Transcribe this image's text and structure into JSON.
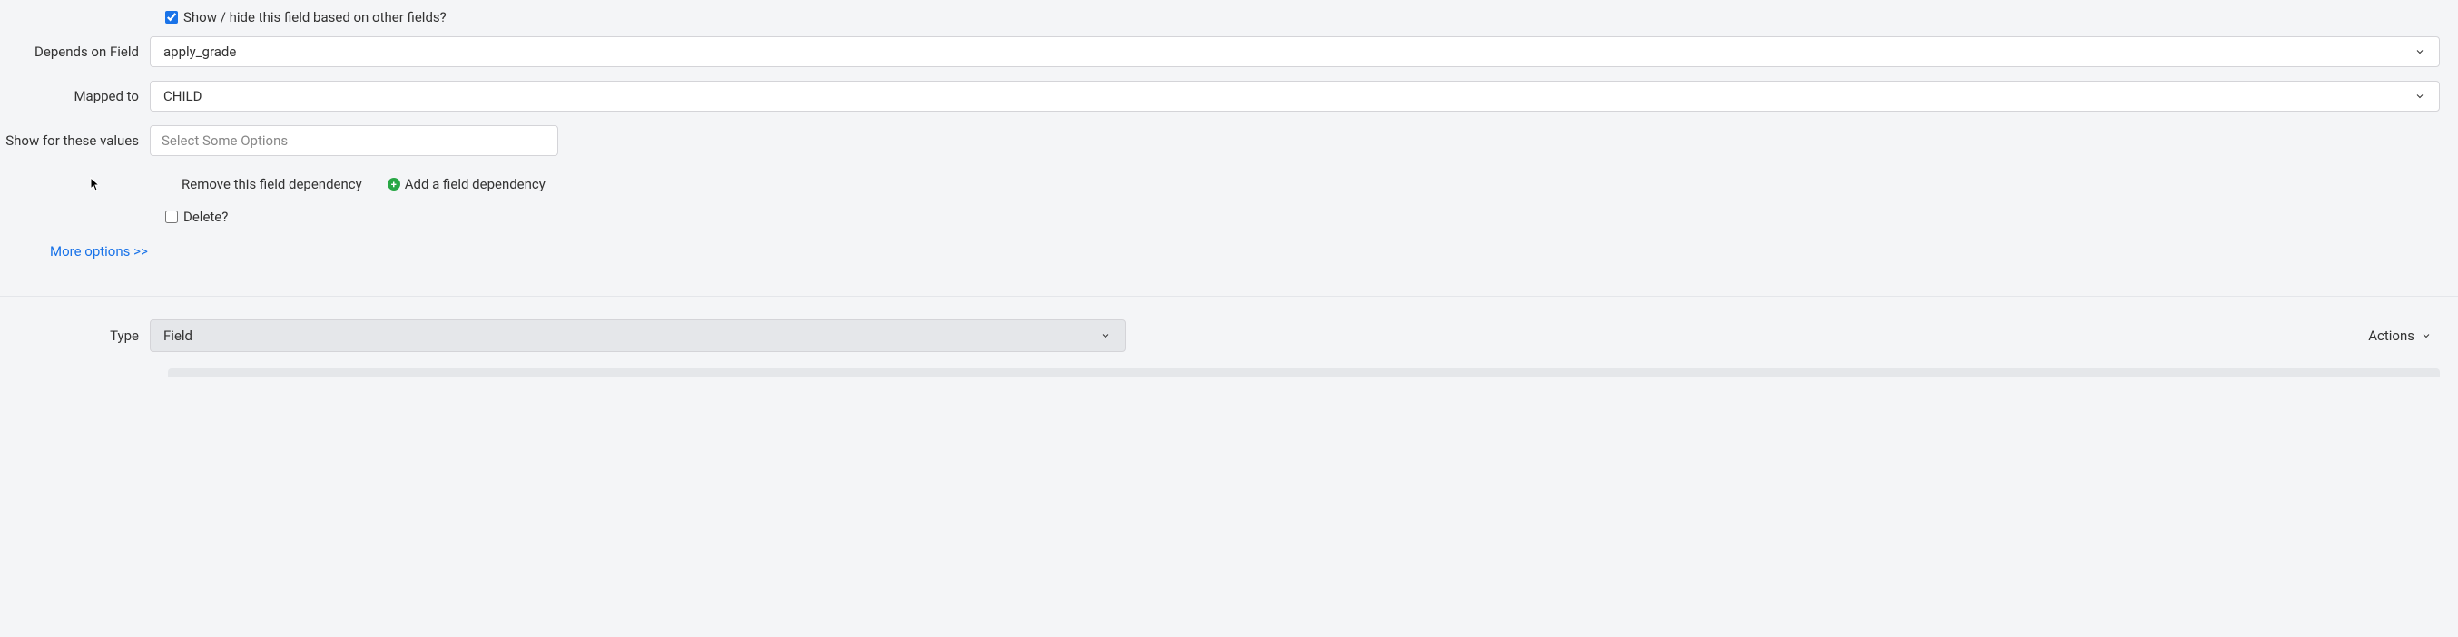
{
  "section1": {
    "showHideCheckbox": {
      "label": "Show / hide this field based on other fields?",
      "checked": true
    },
    "dependsOn": {
      "label": "Depends on Field",
      "value": "apply_grade"
    },
    "mappedTo": {
      "label": "Mapped to",
      "value": "CHILD"
    },
    "showForValues": {
      "label": "Show for these values",
      "placeholder": "Select Some Options"
    },
    "removeLink": "Remove this field dependency",
    "addLink": "Add a field dependency",
    "deleteCheckbox": {
      "label": "Delete?",
      "checked": false
    },
    "moreOptions": "More options >>"
  },
  "section2": {
    "type": {
      "label": "Type",
      "value": "Field"
    },
    "actions": "Actions"
  }
}
